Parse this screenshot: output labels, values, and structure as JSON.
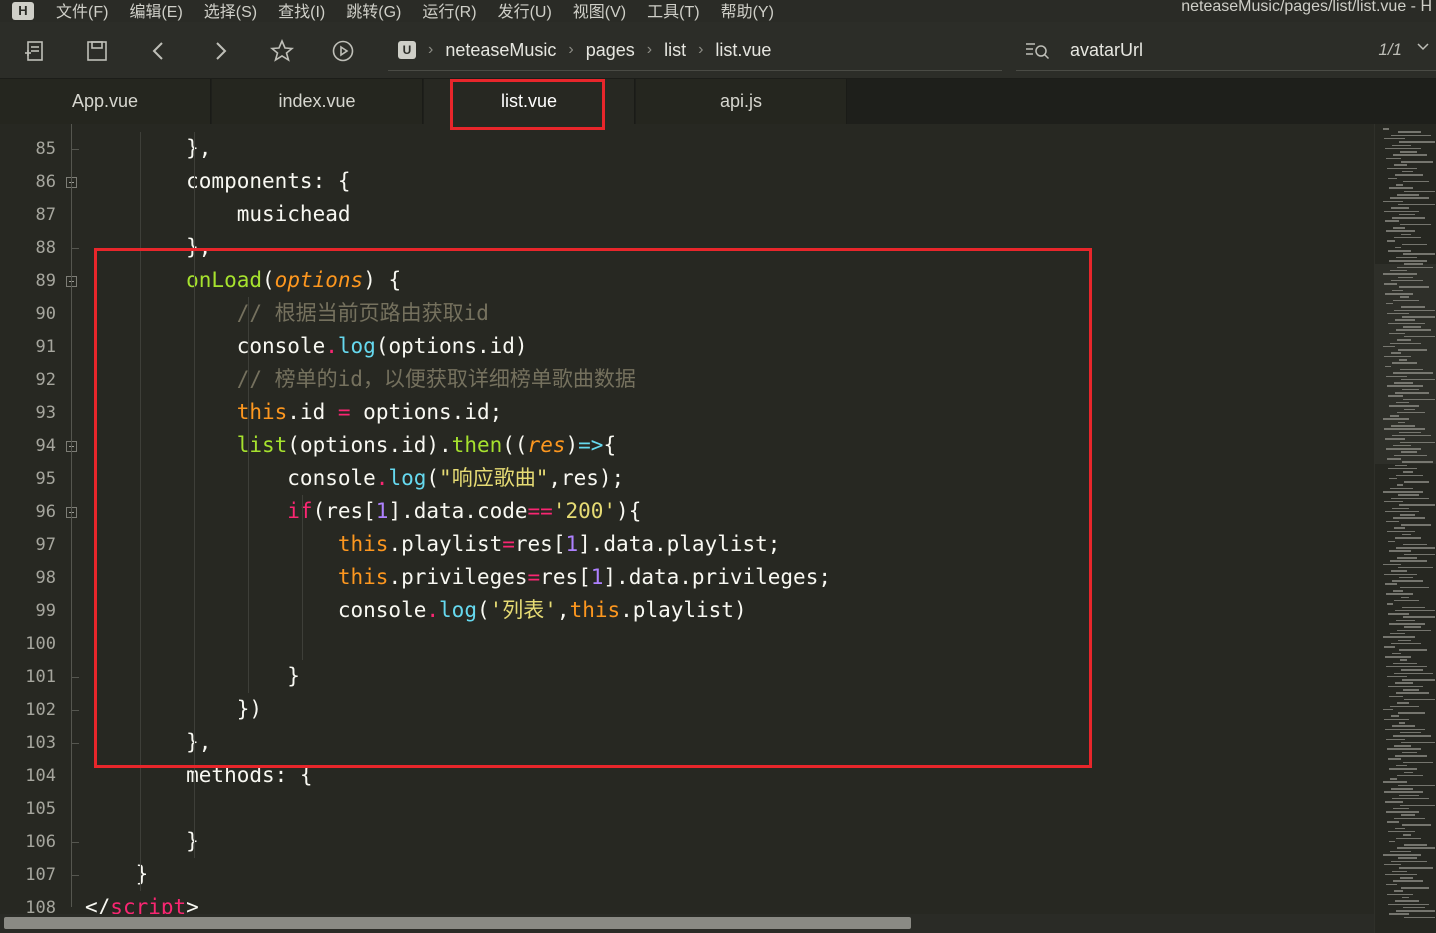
{
  "menubar": {
    "logo": "H",
    "items": [
      "文件(F)",
      "编辑(E)",
      "选择(S)",
      "查找(I)",
      "跳转(G)",
      "运行(R)",
      "发行(U)",
      "视图(V)",
      "工具(T)",
      "帮助(Y)"
    ],
    "window_title": "neteaseMusic/pages/list/list.vue - H"
  },
  "toolbar": {
    "buttons": [
      "new-file-icon",
      "save-icon",
      "back-icon",
      "forward-icon",
      "star-icon",
      "run-icon"
    ],
    "breadcrumb": {
      "file_icon": "U",
      "segments": [
        "neteaseMusic",
        "pages",
        "list",
        "list.vue"
      ],
      "separator": "›"
    },
    "search": {
      "value": "avatarUrl",
      "count": "1/1"
    }
  },
  "tabs": [
    {
      "label": "App.vue",
      "active": false
    },
    {
      "label": "index.vue",
      "active": false
    },
    {
      "label": "list.vue",
      "active": true
    },
    {
      "label": "api.js",
      "active": false
    }
  ],
  "editor": {
    "line_numbers": [
      "85",
      "86",
      "87",
      "88",
      "89",
      "90",
      "91",
      "92",
      "93",
      "94",
      "95",
      "96",
      "97",
      "98",
      "99",
      "100",
      "101",
      "102",
      "103",
      "104",
      "105",
      "106",
      "107",
      "108"
    ],
    "lines": [
      [
        [
          "",
          "        },"
        ]
      ],
      [
        [
          "",
          "        components: {"
        ]
      ],
      [
        [
          "",
          "            musichead"
        ]
      ],
      [
        [
          "",
          "        },"
        ]
      ],
      [
        [
          "f",
          "        onLoad"
        ],
        [
          "",
          "("
        ],
        [
          "p",
          "options"
        ],
        [
          "",
          ") {"
        ]
      ],
      [
        [
          "c",
          "            // 根据当前页路由获取id"
        ]
      ],
      [
        [
          "",
          "            console"
        ],
        [
          "k",
          "."
        ],
        [
          "m",
          "log"
        ],
        [
          "",
          "(options.id)"
        ]
      ],
      [
        [
          "c",
          "            // 榜单的id，以便获取详细榜单歌曲数据"
        ]
      ],
      [
        [
          "t",
          "            this"
        ],
        [
          "",
          ".id "
        ],
        [
          "k",
          "="
        ],
        [
          "",
          " options.id;"
        ]
      ],
      [
        [
          "f",
          "            list"
        ],
        [
          "",
          "(options.id)."
        ],
        [
          "f",
          "then"
        ],
        [
          "",
          "(("
        ],
        [
          "p",
          "res"
        ],
        [
          "",
          ")"
        ],
        [
          "m",
          "=>"
        ],
        [
          "",
          "{"
        ]
      ],
      [
        [
          "",
          "                console"
        ],
        [
          "k",
          "."
        ],
        [
          "m",
          "log"
        ],
        [
          "",
          "("
        ],
        [
          "s",
          "\"响应歌曲\""
        ],
        [
          "",
          ",res);"
        ]
      ],
      [
        [
          "k",
          "                if"
        ],
        [
          "",
          "(res["
        ],
        [
          "n",
          "1"
        ],
        [
          "",
          "].data.code"
        ],
        [
          "k",
          "=="
        ],
        [
          "s",
          "'200'"
        ],
        [
          "",
          "){"
        ]
      ],
      [
        [
          "t",
          "                    this"
        ],
        [
          "",
          ".playlist"
        ],
        [
          "k",
          "="
        ],
        [
          "",
          "res["
        ],
        [
          "n",
          "1"
        ],
        [
          "",
          "].data.playlist;"
        ]
      ],
      [
        [
          "t",
          "                    this"
        ],
        [
          "",
          ".privileges"
        ],
        [
          "k",
          "="
        ],
        [
          "",
          "res["
        ],
        [
          "n",
          "1"
        ],
        [
          "",
          "].data.privileges;"
        ]
      ],
      [
        [
          "",
          "                    console"
        ],
        [
          "k",
          "."
        ],
        [
          "m",
          "log"
        ],
        [
          "",
          "("
        ],
        [
          "s",
          "'列表'"
        ],
        [
          "",
          ","
        ],
        [
          "t",
          "this"
        ],
        [
          "",
          ".playlist)"
        ]
      ],
      [
        [
          "",
          ""
        ]
      ],
      [
        [
          "",
          "                }"
        ]
      ],
      [
        [
          "",
          "            })"
        ]
      ],
      [
        [
          "",
          "        },"
        ]
      ],
      [
        [
          "",
          "        methods: {"
        ]
      ],
      [
        [
          "",
          ""
        ]
      ],
      [
        [
          "",
          "        }"
        ]
      ],
      [
        [
          "",
          "    }"
        ]
      ],
      [
        [
          "",
          "</"
        ],
        [
          "k",
          "script"
        ],
        [
          "",
          ">"
        ]
      ]
    ]
  },
  "colors": {
    "highlight_box": "#e8262b",
    "background": "#272822"
  }
}
